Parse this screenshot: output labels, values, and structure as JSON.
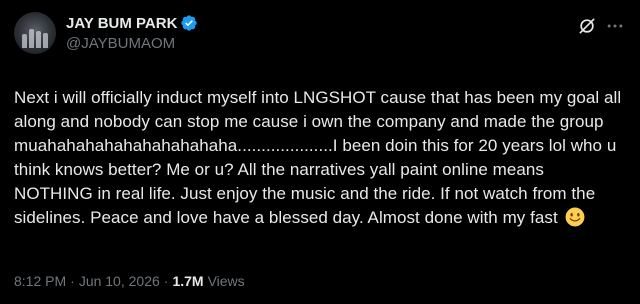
{
  "author": {
    "display_name": "JAY BUM PARK",
    "handle": "@JAYBUMAOM",
    "verified": true,
    "avatar_icon": "profile-avatar"
  },
  "header_icons": {
    "grok": "grok-slash-icon",
    "more": "more-dots-icon"
  },
  "tweet": {
    "text": "Next i will officially induct myself into LNGSHOT cause that has been my goal all along and nobody can stop me cause i own the company and made the group muahahahahahahahahahaha....................I been doin this for 20 years lol who u think knows better? Me or u? All the narratives yall paint online means NOTHING in real life. Just enjoy the music and the ride. If not watch from the sidelines. Peace and love have a blessed day. Almost done with my fast",
    "emoji": "slightly-smiling-face"
  },
  "meta": {
    "time": "8:12 PM",
    "date": "Jun 10, 2026",
    "separator1": "·",
    "separator2": "·",
    "views_count": "1.7M",
    "views_label": "Views"
  },
  "colors": {
    "background": "#000000",
    "text": "#e7e9ea",
    "secondary": "#71767b",
    "verified": "#1d9bf0",
    "emoji": "#ffcc4d"
  }
}
